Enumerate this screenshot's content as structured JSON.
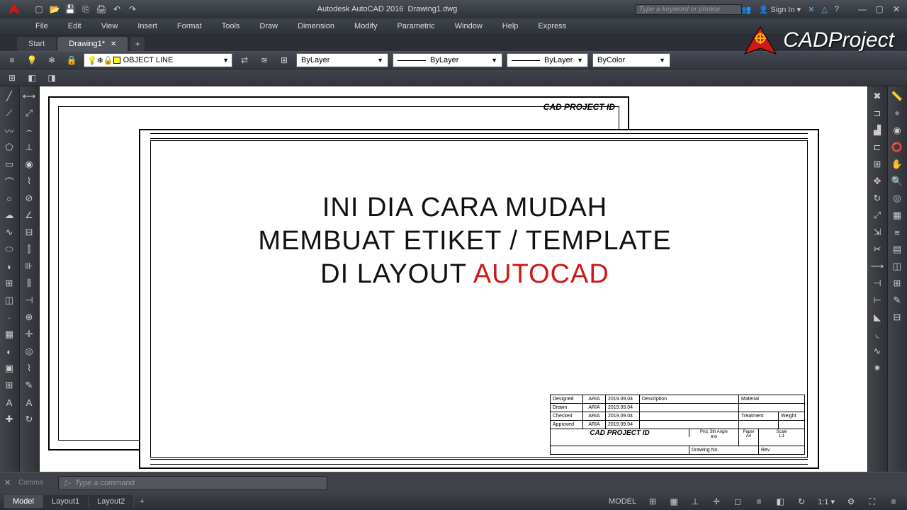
{
  "title": {
    "app": "Autodesk AutoCAD 2016",
    "file": "Drawing1.dwg"
  },
  "search_placeholder": "Type a keyword or phrase",
  "signin": "Sign In",
  "menus": [
    "File",
    "Edit",
    "View",
    "Insert",
    "Format",
    "Tools",
    "Draw",
    "Dimension",
    "Modify",
    "Parametric",
    "Window",
    "Help",
    "Express"
  ],
  "doctabs": {
    "inactive": "Start",
    "active": "Drawing1*",
    "add": "+"
  },
  "layer_combo": "OBJECT LINE",
  "combos": {
    "color": "ByLayer",
    "ltype": "ByLayer",
    "lweight": "ByLayer",
    "plot": "ByColor"
  },
  "overlay_brand": "CADProject",
  "sheet1_label": "CAD PROJECT ID",
  "headline": {
    "l1": "INI DIA CARA MUDAH",
    "l2": "MEMBUAT ETIKET  / TEMPLATE",
    "l3_a": "DI LAYOUT ",
    "l3_b": "AUTOCAD"
  },
  "titleblock": {
    "rows": [
      {
        "a": "Designed",
        "b": "ARIA",
        "c": "2019.09.04"
      },
      {
        "a": "Drawn",
        "b": "ARIA",
        "c": "2019.09.04"
      },
      {
        "a": "Checked",
        "b": "ARIA",
        "c": "2019.09.04"
      },
      {
        "a": "Approved",
        "b": "ARIA",
        "c": "2019.09.04"
      }
    ],
    "desc": "Description",
    "mat": "Material",
    "treat": "Treatment",
    "weight": "Weight",
    "logo": "CAD PROJECT ID",
    "proj": "Proj. 3th Angle",
    "paper": "Paper",
    "scale": "Scale",
    "a4": "A4",
    "s11": "1:1",
    "drawno": "Drawing No.",
    "rev": "Rev"
  },
  "cmdline": {
    "history": "Comma",
    "placeholder": "Type a command"
  },
  "layout_tabs": {
    "model": "Model",
    "l1": "Layout1",
    "l2": "Layout2"
  },
  "status": {
    "model": "MODEL",
    "scale": "1:1"
  }
}
